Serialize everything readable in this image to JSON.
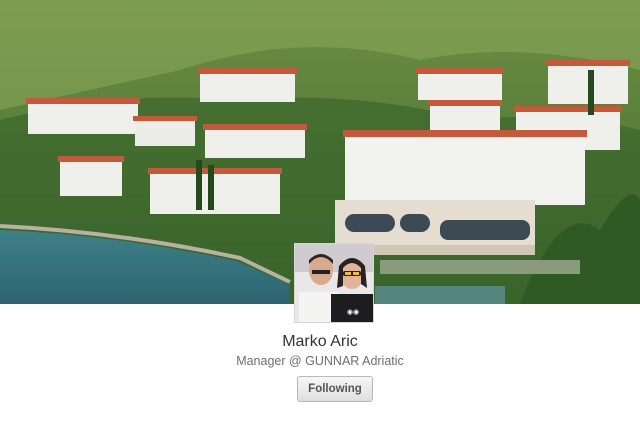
{
  "profile": {
    "name": "Marko Aric",
    "subtitle": "Manager @ GUNNAR Adriatic",
    "follow_button_label": "Following"
  },
  "cover": {
    "description_icon": "cover-photo"
  },
  "avatar": {
    "description_icon": "profile-photo"
  }
}
